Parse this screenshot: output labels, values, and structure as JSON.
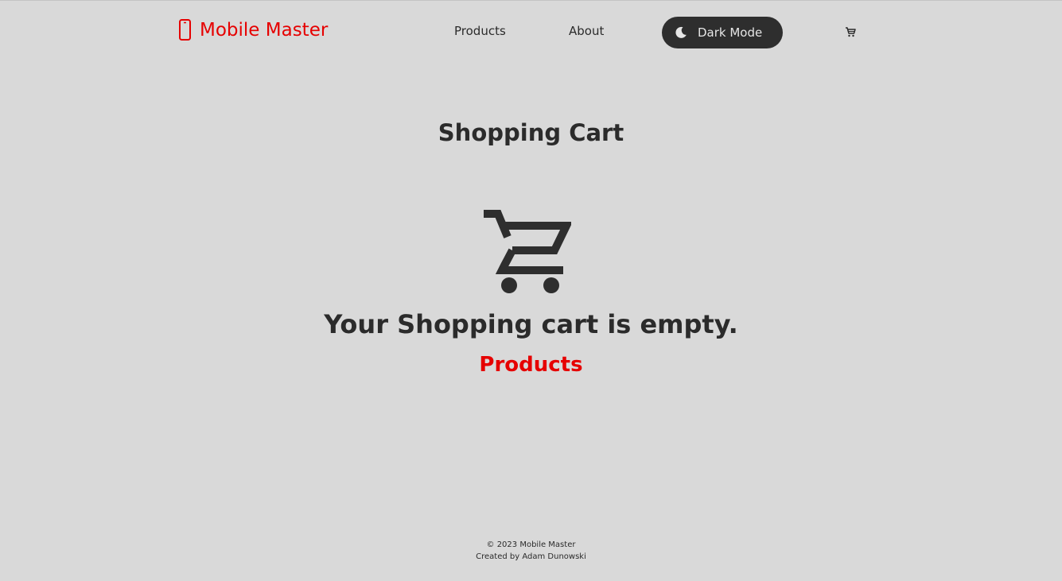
{
  "header": {
    "brand": "Mobile Master",
    "nav": {
      "products": "Products",
      "about": "About"
    },
    "dark_mode_label": "Dark Mode",
    "cart_icon": "cart-icon"
  },
  "main": {
    "title": "Shopping Cart",
    "empty_message": "Your Shopping cart is empty.",
    "products_link": "Products"
  },
  "footer": {
    "copyright": "© 2023 Mobile Master",
    "credit": "Created by Adam Dunowski"
  },
  "colors": {
    "background": "#d9d9d9",
    "accent": "#e60000",
    "text": "#2b2b2b",
    "toggle_bg": "#2e2e2e"
  }
}
